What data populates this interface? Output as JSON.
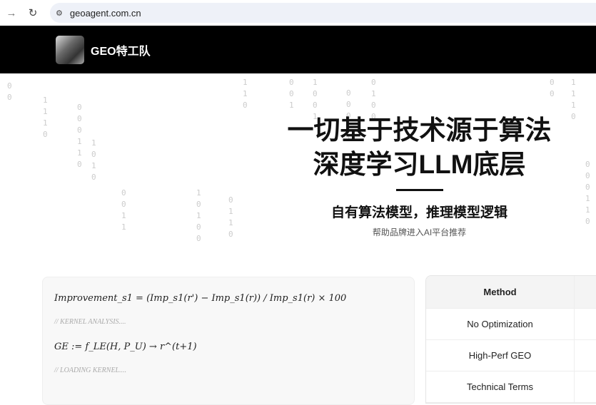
{
  "browser": {
    "url": "geoagent.com.cn",
    "back_icon": "arrow-right",
    "reload_icon": "reload"
  },
  "header": {
    "brand": "GEO特工队"
  },
  "hero": {
    "title_line1": "一切基于技术源于算法",
    "title_line2": "深度学习LLM底层",
    "subtitle": "自有算法模型，推理模型逻辑",
    "tagline": "帮助品牌进入AI平台推荐"
  },
  "rain": [
    "0\n0",
    "1\n1\n1\n0",
    "0\n0\n0\n1\n1\n0",
    "1\n0\n1\n0",
    "0\n0\n1\n1",
    "1\n0\n1\n0\n0",
    "0\n1\n1\n0",
    "1\n1\n0",
    "0\n0\n1",
    "1\n0\n0\n1",
    "0\n0\n0\n1\n1",
    "0\n1\n0\n0"
  ],
  "formula": {
    "line1": "Improvement_s1 = (Imp_s1(r') − Imp_s1(r)) / Imp_s1(r) × 100",
    "comment1": "// KERNEL ANALYSIS....",
    "line2": "GE := f_LE(H, P_U) → r^(t+1)",
    "comment2": "// LOADING KERNEL...."
  },
  "table": {
    "header": "Method",
    "rows": [
      "No Optimization",
      "High-Perf GEO",
      "Technical Terms"
    ]
  }
}
